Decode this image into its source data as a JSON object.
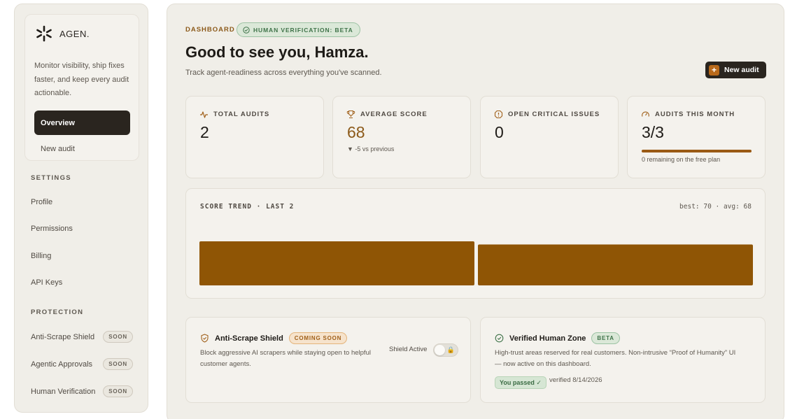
{
  "brand": {
    "name": "AGEN.",
    "description": "Monitor visibility, ship fixes faster, and keep every audit actionable."
  },
  "sidebar": {
    "primary": [
      {
        "label": "Overview",
        "active": true
      },
      {
        "label": "New audit",
        "active": false
      }
    ],
    "settings_heading": "SETTINGS",
    "settings": [
      "Profile",
      "Permissions",
      "Billing",
      "API Keys"
    ],
    "protection_heading": "PROTECTION",
    "protection": [
      {
        "label": "Anti-Scrape Shield",
        "badge": "SOON"
      },
      {
        "label": "Agentic Approvals",
        "badge": "SOON"
      },
      {
        "label": "Human Verification",
        "badge": "SOON"
      }
    ]
  },
  "header": {
    "kicker": "DASHBOARD",
    "pill": "HUMAN VERIFICATION: BETA",
    "greeting": "Good to see you, Hamza.",
    "subtitle": "Track agent-readiness across everything you've scanned.",
    "new_audit_icon": "+",
    "new_audit_label": "New audit"
  },
  "stats": {
    "total": {
      "label": "TOTAL AUDITS",
      "value": "2",
      "icon": "pulse-icon"
    },
    "average": {
      "label": "AVERAGE SCORE",
      "value": "68",
      "note": "▼ -5 vs previous",
      "icon": "trophy-icon"
    },
    "critical": {
      "label": "OPEN CRITICAL ISSUES",
      "value": "0",
      "icon": "alert-icon"
    },
    "month": {
      "label": "AUDITS THIS MONTH",
      "value": "3/3",
      "progress": 1.0,
      "note": "0 remaining on the free plan",
      "icon": "gauge-icon"
    }
  },
  "trend": {
    "title": "SCORE TREND · LAST 2",
    "meta": "best: 70 · avg: 68"
  },
  "chart_data": {
    "type": "bar",
    "categories": [
      "",
      ""
    ],
    "values": [
      70,
      65
    ],
    "color": "#8f5505"
  },
  "features": {
    "shield": {
      "title": "Anti-Scrape Shield",
      "tag": "COMING SOON",
      "desc_line1": "Block aggressive AI scrapers while staying open to helpful",
      "desc_line2": "customer agents.",
      "toggle_label": "Shield Active",
      "toggle_icon": "🔒"
    },
    "human": {
      "title": "Verified Human Zone",
      "tag": "BETA",
      "desc_line1": "High-trust areas reserved for real customers. Non-intrusive “Proof of Humanity” UI",
      "desc_line2": "— now active on this dashboard.",
      "passed": "You passed ✓",
      "verified": "verified 8/14/2026"
    }
  },
  "colors": {
    "accent": "#8c5a1a",
    "dark": "#2a251f",
    "success": "#3f7349",
    "bar": "#8f5505"
  }
}
